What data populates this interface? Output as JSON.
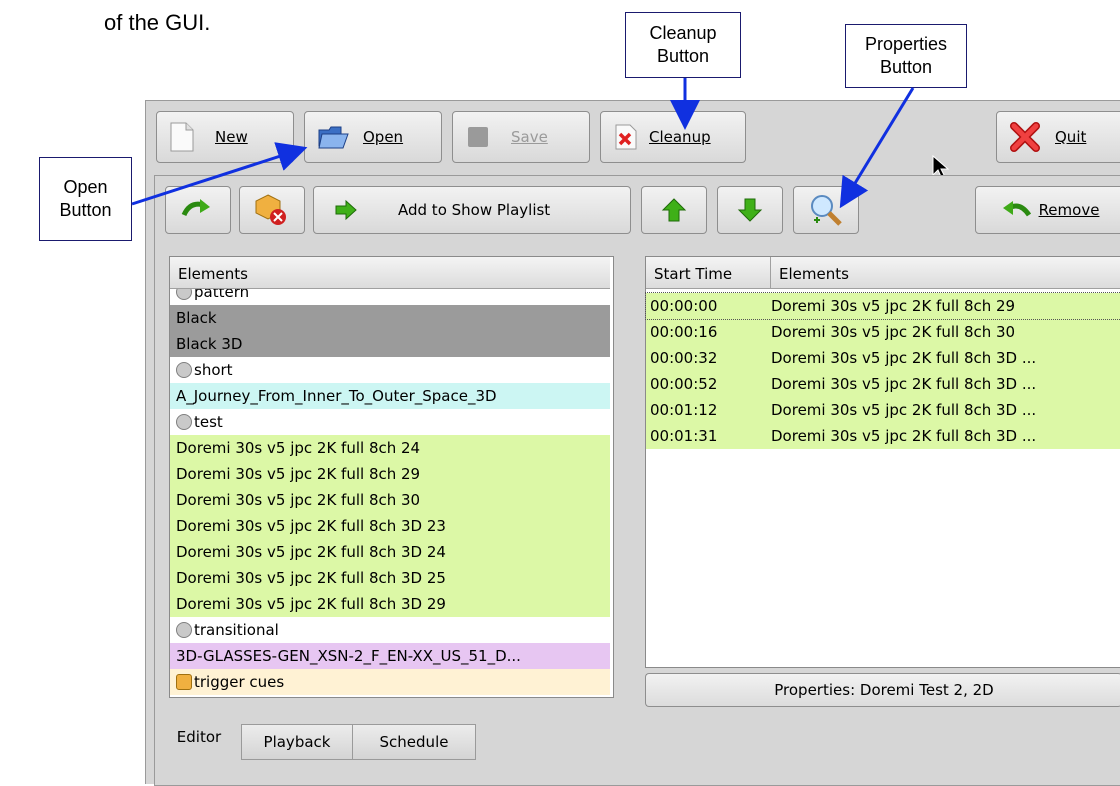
{
  "doc": {
    "line_partial": "of the GUI."
  },
  "callouts": {
    "open": [
      "Open",
      "Button"
    ],
    "cleanup": [
      "Cleanup",
      "Button"
    ],
    "properties": [
      "Properties",
      "Button"
    ]
  },
  "toolbar": {
    "new_label": "New",
    "open_label": "Open",
    "save_label": "Save",
    "cleanup_label": "Cleanup",
    "quit_label": "Quit"
  },
  "toolbar2": {
    "add_to_playlist_label": "Add to Show Playlist",
    "remove_label": "Remove"
  },
  "elements_list": {
    "header": "Elements",
    "rows": [
      {
        "label": "pattern",
        "style": "white",
        "icon": "reel-icon"
      },
      {
        "label": "Black",
        "style": "gray"
      },
      {
        "label": "Black 3D",
        "style": "gray"
      },
      {
        "label": "short",
        "style": "white",
        "icon": "reel-icon"
      },
      {
        "label": "A_Journey_From_Inner_To_Outer_Space_3D",
        "style": "cyan"
      },
      {
        "label": "test",
        "style": "white",
        "icon": "reel-icon"
      },
      {
        "label": "Doremi 30s v5 jpc 2K full 8ch 24",
        "style": "green"
      },
      {
        "label": "Doremi 30s v5 jpc 2K full 8ch 29",
        "style": "green"
      },
      {
        "label": "Doremi 30s v5 jpc 2K full 8ch 30",
        "style": "green"
      },
      {
        "label": "Doremi 30s v5 jpc 2K full 8ch 3D 23",
        "style": "green"
      },
      {
        "label": "Doremi 30s v5 jpc 2K full 8ch 3D 24",
        "style": "green"
      },
      {
        "label": "Doremi 30s v5 jpc 2K full 8ch 3D 25",
        "style": "green"
      },
      {
        "label": "Doremi 30s v5 jpc 2K full 8ch 3D 29",
        "style": "green"
      },
      {
        "label": "transitional",
        "style": "white",
        "icon": "reel-icon"
      },
      {
        "label": "3D-GLASSES-GEN_XSN-2_F_EN-XX_US_51_D...",
        "style": "purple"
      },
      {
        "label": "trigger cues",
        "style": "cream",
        "icon": "bell-icon"
      }
    ]
  },
  "playlist": {
    "col_start": "Start Time",
    "col_elements": "Elements",
    "rows": [
      {
        "time": "00:00:00",
        "element": "Doremi 30s v5 jpc 2K full 8ch 29"
      },
      {
        "time": "00:00:16",
        "element": "Doremi 30s v5 jpc 2K full 8ch 30"
      },
      {
        "time": "00:00:32",
        "element": "Doremi 30s v5 jpc 2K full 8ch 3D ..."
      },
      {
        "time": "00:00:52",
        "element": "Doremi 30s v5 jpc 2K full 8ch 3D ..."
      },
      {
        "time": "00:01:12",
        "element": "Doremi 30s v5 jpc 2K full 8ch 3D ..."
      },
      {
        "time": "00:01:31",
        "element": "Doremi 30s v5 jpc 2K full 8ch 3D ..."
      }
    ]
  },
  "properties_bar": "Properties: Doremi Test 2, 2D",
  "tabs": [
    "Editor",
    "Playback",
    "Schedule"
  ],
  "colors": {
    "callout_arrow": "#1030e0",
    "row_green": "#dcf8a6",
    "row_cyan": "#ccf6f3",
    "row_purple": "#e7c6f2",
    "row_gray": "#9b9b9b"
  }
}
